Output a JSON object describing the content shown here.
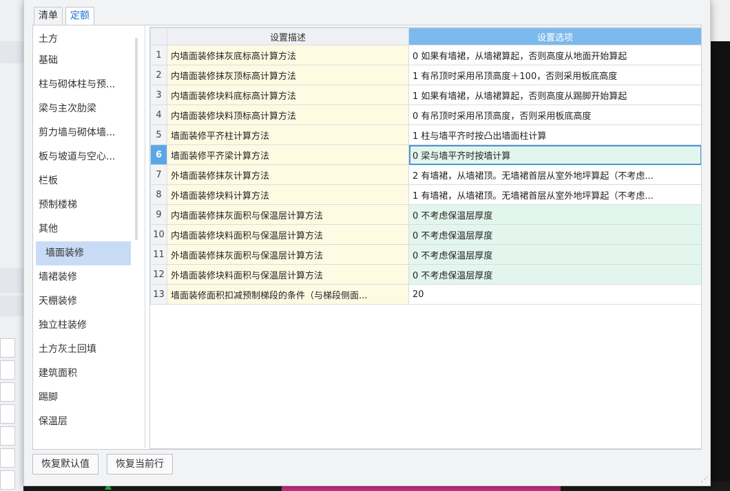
{
  "tabs": [
    {
      "label": "清单"
    },
    {
      "label": "定额"
    }
  ],
  "categories": [
    "土方",
    "基础",
    "柱与砌体柱与预...",
    "梁与主次肋梁",
    "剪力墙与砌体墙...",
    "板与坡道与空心...",
    "栏板",
    "预制楼梯",
    "其他",
    "墙面装修",
    "墙裙装修",
    "天棚装修",
    "独立柱装修",
    "土方灰土回填",
    "建筑面积",
    "踢脚",
    "保温层"
  ],
  "selected_category": "墙面装修",
  "table": {
    "columns": {
      "desc": "设置描述",
      "option": "设置选项"
    },
    "rows": [
      {
        "no": "1",
        "desc": "内墙面装修抹灰底标高计算方法",
        "value": "0 如果有墙裙，从墙裙算起，否则高度从地面开始算起"
      },
      {
        "no": "2",
        "desc": "内墙面装修抹灰顶标高计算方法",
        "value": "1 有吊顶时采用吊顶高度＋100，否则采用板底高度"
      },
      {
        "no": "3",
        "desc": "内墙面装修块料底标高计算方法",
        "value": "1 如果有墙裙，从墙裙算起，否则高度从踢脚开始算起"
      },
      {
        "no": "4",
        "desc": "内墙面装修块料顶标高计算方法",
        "value": "0 有吊顶时采用吊顶高度，否则采用板底高度"
      },
      {
        "no": "5",
        "desc": "墙面装修平齐柱计算方法",
        "value": "1 柱与墙平齐时按凸出墙面柱计算"
      },
      {
        "no": "6",
        "desc": "墙面装修平齐梁计算方法",
        "value": "0 梁与墙平齐时按墙计算"
      },
      {
        "no": "7",
        "desc": "外墙面装修抹灰计算方法",
        "value": "2 有墙裙，从墙裙顶。无墙裙首层从室外地坪算起（不考虑..."
      },
      {
        "no": "8",
        "desc": "外墙面装修块料计算方法",
        "value": "1 有墙裙，从墙裙顶。无墙裙首层从室外地坪算起（不考虑..."
      },
      {
        "no": "9",
        "desc": "内墙面装修抹灰面积与保温层计算方法",
        "value": "0 不考虑保温层厚度"
      },
      {
        "no": "10",
        "desc": "内墙面装修块料面积与保温层计算方法",
        "value": "0 不考虑保温层厚度"
      },
      {
        "no": "11",
        "desc": "外墙面装修抹灰面积与保温层计算方法",
        "value": "0 不考虑保温层厚度"
      },
      {
        "no": "12",
        "desc": "外墙面装修块料面积与保温层计算方法",
        "value": "0 不考虑保温层厚度"
      },
      {
        "no": "13",
        "desc": "墙面装修面积扣减预制梯段的条件（与梯段侧面...",
        "value": "20"
      }
    ],
    "selected_row": "6"
  },
  "buttons": {
    "restore_default": "恢复默认值",
    "restore_current": "恢复当前行"
  },
  "colors": {
    "header_option_bg": "#7cb9ec",
    "desc_bg": "#fffbe3",
    "green_value_bg": "#e3f6ee",
    "selected_category_bg": "#c8dcf5",
    "active_tab_text": "#1e73d8"
  }
}
